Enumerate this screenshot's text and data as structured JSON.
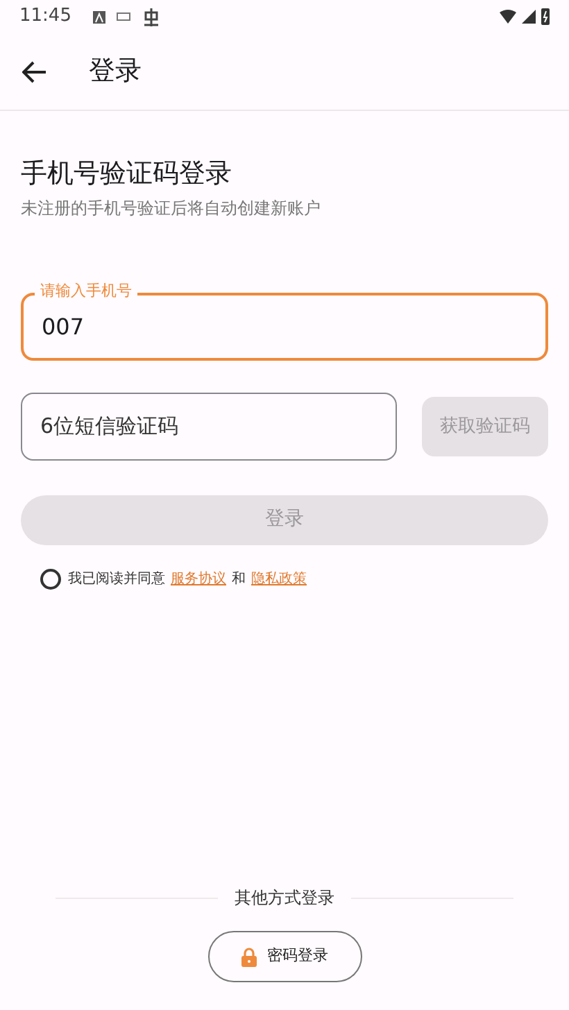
{
  "status_bar": {
    "time": "11:45"
  },
  "app_bar": {
    "title": "登录"
  },
  "heading": {
    "title": "手机号验证码登录",
    "subtitle": "未注册的手机号验证后将自动创建新账户"
  },
  "phone_field": {
    "label": "请输入手机号",
    "value": "007",
    "focused": true
  },
  "code_field": {
    "placeholder": "6位短信验证码"
  },
  "get_code_button": {
    "label": "获取验证码",
    "disabled": true
  },
  "login_button": {
    "label": "登录",
    "disabled": true
  },
  "agreement": {
    "checked": false,
    "text": "我已阅读并同意",
    "terms_link": "服务协议",
    "and": "和",
    "privacy_link": "隐私政策"
  },
  "other_methods": {
    "label": "其他方式登录",
    "buttons": [
      {
        "label": "密码登录",
        "kind": "password"
      }
    ]
  }
}
